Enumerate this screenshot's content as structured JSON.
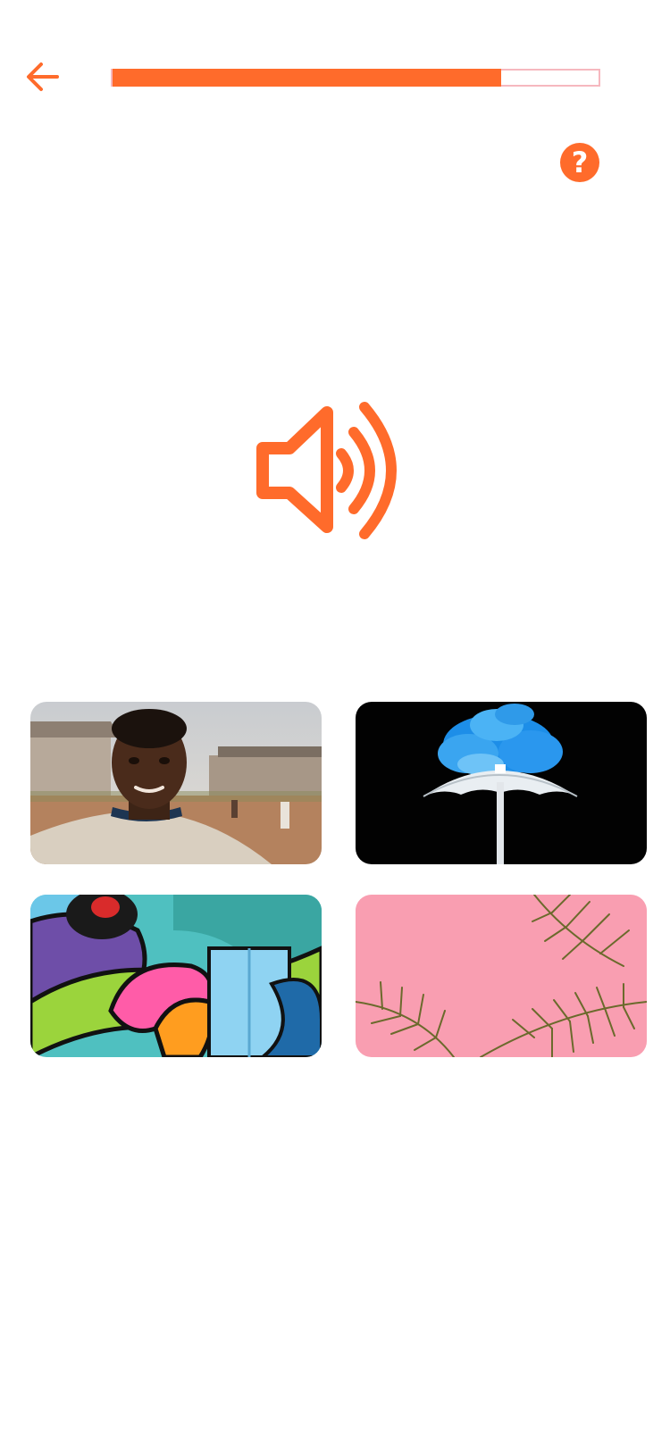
{
  "header": {
    "back_icon": "arrow-left-icon",
    "progress": 0.8,
    "help_icon": "question-mark-icon",
    "help_glyph": "?"
  },
  "prompt": {
    "audio_icon": "speaker-icon"
  },
  "choices": [
    {
      "subject": "boy-portrait"
    },
    {
      "subject": "umbrella-blue-smoke"
    },
    {
      "subject": "graffiti-wall"
    },
    {
      "subject": "palm-leaves-pink-wall"
    }
  ],
  "colors": {
    "accent": "#ff6b2b",
    "progress_track_border": "#f6b8bf",
    "background": "#ffffff"
  }
}
